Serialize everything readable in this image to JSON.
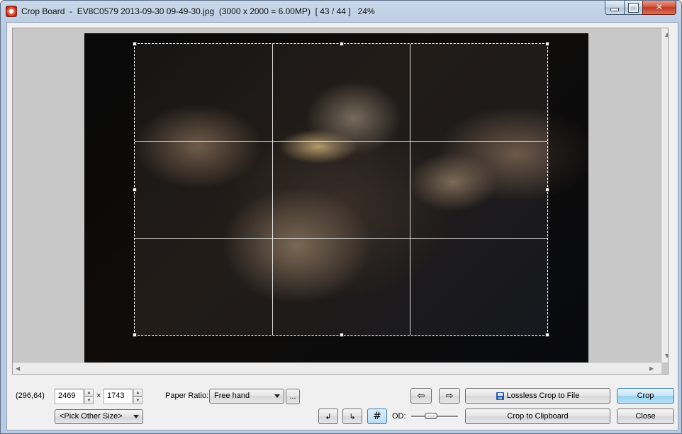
{
  "window": {
    "title": "Crop Board  -  EV8C0579 2013-09-30 09-49-30.jpg  (3000 x 2000 = 6.00MP)  [ 43 / 44 ]   24%"
  },
  "status": {
    "coordinates": "(296,64)"
  },
  "size": {
    "width": "2469",
    "separator": "×",
    "height": "1743",
    "preset": "<Pick Other Size>"
  },
  "paper_ratio": {
    "label": "Paper Ratio:",
    "value": "Free hand",
    "more_label": "..."
  },
  "toolbar": {
    "prev_icon": "arrow-left-icon",
    "next_icon": "arrow-right-icon",
    "rotate_left_icon": "rotate-left-icon",
    "rotate_right_icon": "rotate-right-icon",
    "grid_icon": "grid-icon",
    "od_label": "OD:",
    "od_level": 0.4
  },
  "actions": {
    "lossless_crop": "Lossless Crop to File",
    "crop": "Crop",
    "crop_clipboard": "Crop to Clipboard",
    "close": "Close"
  },
  "colors": {
    "default_button": "#98d1ef",
    "titlebar": "#b9cbe1"
  }
}
